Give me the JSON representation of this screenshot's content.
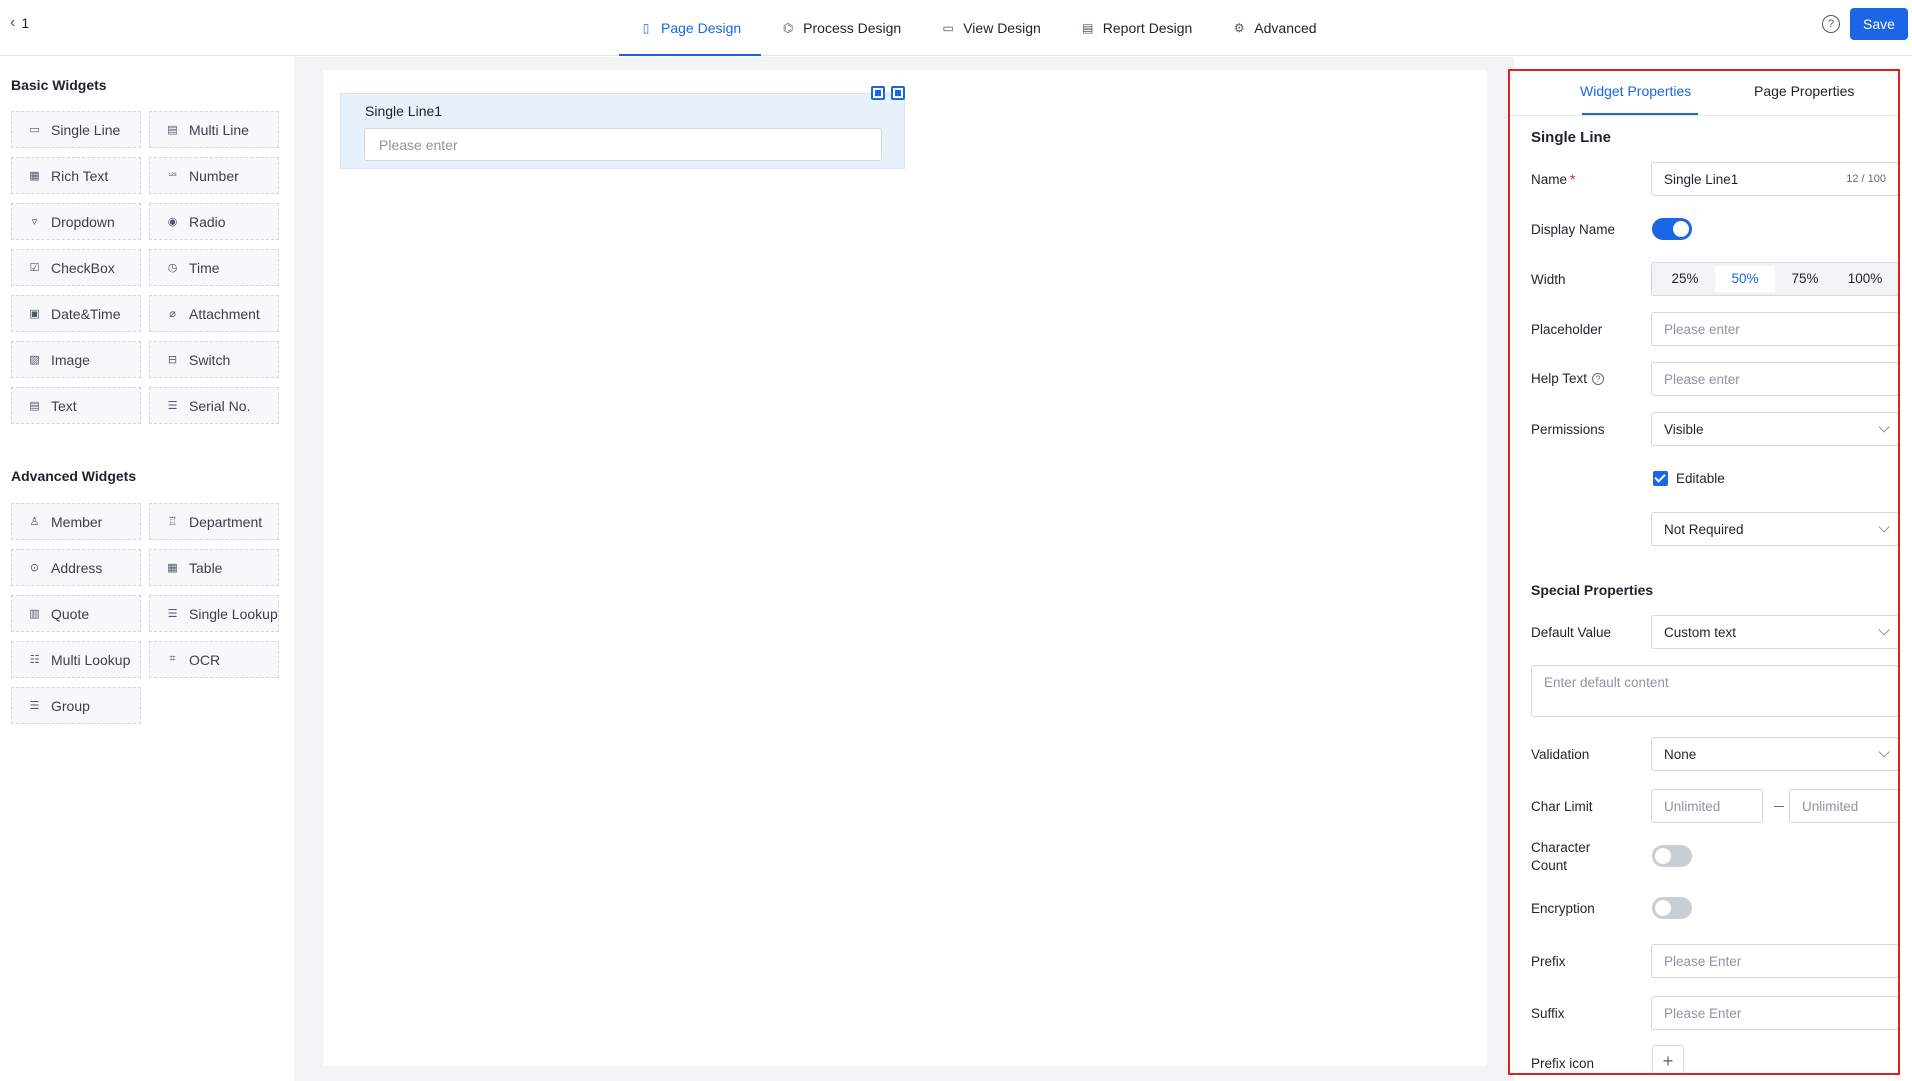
{
  "header": {
    "back_label": "1",
    "tabs": [
      {
        "label": "Page Design",
        "icon": "page-icon"
      },
      {
        "label": "Process Design",
        "icon": "process-icon"
      },
      {
        "label": "View Design",
        "icon": "view-icon"
      },
      {
        "label": "Report Design",
        "icon": "report-icon"
      },
      {
        "label": "Advanced",
        "icon": "gear-icon"
      }
    ],
    "active_tab": "Page Design",
    "help_label": "?",
    "save_label": "Save",
    "accent_color": "#1a66e6"
  },
  "left": {
    "basic_title": "Basic Widgets",
    "basic": [
      {
        "label": "Single Line",
        "icon": "▭"
      },
      {
        "label": "Multi Line",
        "icon": "▤"
      },
      {
        "label": "Rich Text",
        "icon": "▦"
      },
      {
        "label": "Number",
        "icon": "¹²³"
      },
      {
        "label": "Dropdown",
        "icon": "▿"
      },
      {
        "label": "Radio",
        "icon": "◉"
      },
      {
        "label": "CheckBox",
        "icon": "☑"
      },
      {
        "label": "Time",
        "icon": "◷"
      },
      {
        "label": "Date&Time",
        "icon": "▣"
      },
      {
        "label": "Attachment",
        "icon": "⌀"
      },
      {
        "label": "Image",
        "icon": "▨"
      },
      {
        "label": "Switch",
        "icon": "⊟"
      },
      {
        "label": "Text",
        "icon": "▤"
      },
      {
        "label": "Serial No.",
        "icon": "☰"
      }
    ],
    "advanced_title": "Advanced Widgets",
    "advanced": [
      {
        "label": "Member",
        "icon": "♙"
      },
      {
        "label": "Department",
        "icon": "♖"
      },
      {
        "label": "Address",
        "icon": "⊙"
      },
      {
        "label": "Table",
        "icon": "▦"
      },
      {
        "label": "Quote",
        "icon": "▥"
      },
      {
        "label": "Single Lookup",
        "icon": "☰"
      },
      {
        "label": "Multi Lookup",
        "icon": "☷"
      },
      {
        "label": "OCR",
        "icon": "⌗"
      },
      {
        "label": "Group",
        "icon": "☰"
      }
    ]
  },
  "canvas": {
    "field_label": "Single Line1",
    "field_placeholder": "Please enter"
  },
  "right": {
    "tabs": [
      "Widget Properties",
      "Page Properties"
    ],
    "active_tab": "Widget Properties",
    "title": "Single Line",
    "name_label": "Name",
    "name_value": "Single Line1",
    "name_counter": "12 / 100",
    "display_name_label": "Display Name",
    "display_name_on": true,
    "width_label": "Width",
    "width_options": [
      "25%",
      "50%",
      "75%",
      "100%"
    ],
    "width_selected": "50%",
    "placeholder_label": "Placeholder",
    "placeholder_value": "Please enter",
    "help_text_label": "Help Text",
    "help_text_value": "Please enter",
    "permissions_label": "Permissions",
    "permissions_value": "Visible",
    "editable_label": "Editable",
    "required_value": "Not Required",
    "special_title": "Special Properties",
    "default_value_label": "Default Value",
    "default_value_type": "Custom text",
    "default_content_placeholder": "Enter default content",
    "validation_label": "Validation",
    "validation_value": "None",
    "char_limit_label": "Char Limit",
    "char_limit_min": "Unlimited",
    "char_limit_max": "Unlimited",
    "character_count_label": "Character Count",
    "encryption_label": "Encryption",
    "prefix_label": "Prefix",
    "prefix_placeholder": "Please Enter",
    "suffix_label": "Suffix",
    "suffix_placeholder": "Please Enter",
    "prefix_icon_label": "Prefix icon",
    "prefix_icon_add": "+"
  }
}
